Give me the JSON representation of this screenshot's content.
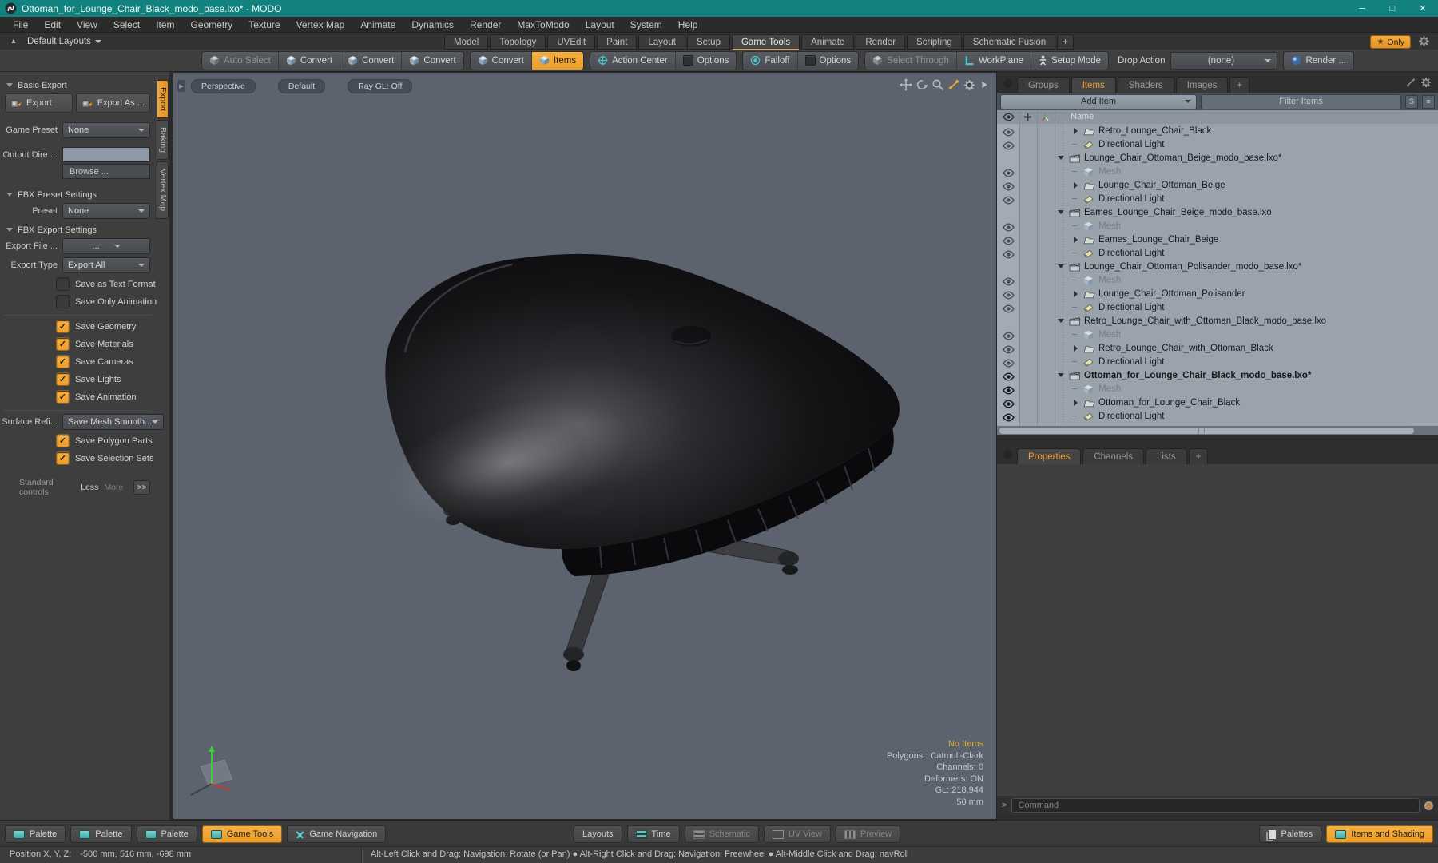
{
  "window": {
    "title": "Ottoman_for_Lounge_Chair_Black_modo_base.lxo* - MODO"
  },
  "colors": {
    "accent_orange": "#f0a030",
    "titlebar_teal": "#11827e",
    "icon_teal": "#4fc3c7",
    "list_bg": "#9aa3ac",
    "viewport_bg": "#5c636e",
    "no_items_text": "#e0ad3c"
  },
  "menubar": {
    "items": [
      {
        "label": "File"
      },
      {
        "label": "Edit"
      },
      {
        "label": "View"
      },
      {
        "label": "Select"
      },
      {
        "label": "Item"
      },
      {
        "label": "Geometry"
      },
      {
        "label": "Texture"
      },
      {
        "label": "Vertex Map"
      },
      {
        "label": "Animate"
      },
      {
        "label": "Dynamics"
      },
      {
        "label": "Render"
      },
      {
        "label": "MaxToModo"
      },
      {
        "label": "Layout"
      },
      {
        "label": "System"
      },
      {
        "label": "Help"
      }
    ]
  },
  "layouts_row": {
    "switcher": "Default Layouts",
    "tabs": [
      {
        "label": "Model"
      },
      {
        "label": "Topology"
      },
      {
        "label": "UVEdit"
      },
      {
        "label": "Paint"
      },
      {
        "label": "Layout"
      },
      {
        "label": "Setup"
      },
      {
        "label": "Game Tools",
        "active": true
      },
      {
        "label": "Animate"
      },
      {
        "label": "Render"
      },
      {
        "label": "Scripting"
      },
      {
        "label": "Schematic Fusion"
      },
      {
        "label": "+",
        "add": true
      }
    ],
    "only_button": "Only"
  },
  "toolbar": {
    "auto_select": "Auto Select",
    "convert1": "Convert",
    "convert2": "Convert",
    "convert3": "Convert",
    "convert4": "Convert",
    "items": "Items",
    "action_center": "Action Center",
    "options1": "Options",
    "falloff": "Falloff",
    "options2": "Options",
    "select_through": "Select Through",
    "workplane": "WorkPlane",
    "setup_mode": "Setup Mode",
    "drop_action_label": "Drop Action",
    "drop_action_value": "(none)",
    "render": "Render ..."
  },
  "left_panel": {
    "vertical_tabs": [
      {
        "label": "Export",
        "active": true
      },
      {
        "label": "Baking"
      },
      {
        "label": "Vertex Map"
      }
    ],
    "basic_export": {
      "title": "Basic Export",
      "export_button": "Export",
      "export_as_button": "Export As ...",
      "game_preset_label": "Game Preset",
      "game_preset_value": "None",
      "output_dir_label": "Output Dire ...",
      "browse_button": "Browse ..."
    },
    "fbx_preset": {
      "title": "FBX Preset Settings",
      "preset_label": "Preset",
      "preset_value": "None"
    },
    "fbx_export": {
      "title": "FBX Export Settings",
      "export_file_label": "Export File ...",
      "export_file_value": "...",
      "export_type_label": "Export Type",
      "export_type_value": "Export All",
      "plain_checkboxes": [
        {
          "label": "Save as Text Format"
        },
        {
          "label": "Save Only Animation"
        }
      ],
      "save_checkboxes": [
        {
          "label": "Save Geometry",
          "checked": true
        },
        {
          "label": "Save Materials",
          "checked": true
        },
        {
          "label": "Save Cameras",
          "checked": true
        },
        {
          "label": "Save Lights",
          "checked": true
        },
        {
          "label": "Save Animation",
          "checked": true
        }
      ],
      "surface_label": "Surface Refi...",
      "surface_value": "Save Mesh Smooth...",
      "extra_checkboxes": [
        {
          "label": "Save Polygon Parts",
          "checked": true
        },
        {
          "label": "Save Selection Sets",
          "checked": true
        }
      ],
      "footer_label": "Standard controls",
      "footer_less": "Less",
      "footer_more": "More",
      "footer_expand": ">>"
    }
  },
  "viewport": {
    "mode_buttons": [
      {
        "label": "Perspective"
      },
      {
        "label": "Default"
      },
      {
        "label": "Ray GL: Off"
      }
    ],
    "status_highlight": "No Items",
    "status_lines": [
      {
        "label": "Polygons : Catmull-Clark"
      },
      {
        "label": "Channels: 0"
      },
      {
        "label": "Deformers: ON"
      },
      {
        "label": "GL: 218,944"
      },
      {
        "label": "50 mm"
      }
    ]
  },
  "items_panel": {
    "tabs": [
      {
        "label": "Groups"
      },
      {
        "label": "Items",
        "active": true
      },
      {
        "label": "Shaders"
      },
      {
        "label": "Images"
      },
      {
        "label": "+",
        "add": true
      }
    ],
    "add_item_button": "Add Item",
    "filter_placeholder": "Filter Items",
    "name_header": "Name",
    "rows": [
      {
        "kind": "group",
        "caret": "right",
        "visible": true,
        "label": "Retro_Lounge_Chair_Black"
      },
      {
        "kind": "light",
        "caret": "none",
        "visible": true,
        "label": "Directional Light"
      },
      {
        "kind": "scene",
        "caret": "down",
        "label": "Lounge_Chair_Ottoman_Beige_modo_base.lxo*"
      },
      {
        "kind": "mesh",
        "caret": "none",
        "visible": true,
        "dim": true,
        "label": "Mesh"
      },
      {
        "kind": "group",
        "caret": "right",
        "visible": true,
        "label": "Lounge_Chair_Ottoman_Beige"
      },
      {
        "kind": "light",
        "caret": "none",
        "visible": true,
        "label": "Directional Light"
      },
      {
        "kind": "scene",
        "caret": "down",
        "label": "Eames_Lounge_Chair_Beige_modo_base.lxo"
      },
      {
        "kind": "mesh",
        "caret": "none",
        "visible": true,
        "dim": true,
        "label": "Mesh"
      },
      {
        "kind": "group",
        "caret": "right",
        "visible": true,
        "label": "Eames_Lounge_Chair_Beige"
      },
      {
        "kind": "light",
        "caret": "none",
        "visible": true,
        "label": "Directional Light"
      },
      {
        "kind": "scene",
        "caret": "down",
        "label": "Lounge_Chair_Ottoman_Polisander_modo_base.lxo*"
      },
      {
        "kind": "mesh",
        "caret": "none",
        "visible": true,
        "dim": true,
        "label": "Mesh"
      },
      {
        "kind": "group",
        "caret": "right",
        "visible": true,
        "label": "Lounge_Chair_Ottoman_Polisander"
      },
      {
        "kind": "light",
        "caret": "none",
        "visible": true,
        "label": "Directional Light"
      },
      {
        "kind": "scene",
        "caret": "down",
        "label": "Retro_Lounge_Chair_with_Ottoman_Black_modo_base.lxo"
      },
      {
        "kind": "mesh",
        "caret": "none",
        "visible": true,
        "dim": true,
        "label": "Mesh"
      },
      {
        "kind": "group",
        "caret": "right",
        "visible": true,
        "label": "Retro_Lounge_Chair_with_Ottoman_Black"
      },
      {
        "kind": "light",
        "caret": "none",
        "visible": true,
        "label": "Directional Light"
      },
      {
        "kind": "scene",
        "caret": "down",
        "visible": true,
        "strong": true,
        "eyebold": true,
        "label": "Ottoman_for_Lounge_Chair_Black_modo_base.lxo*"
      },
      {
        "kind": "mesh",
        "caret": "none",
        "visible": true,
        "dim": true,
        "eyebold": true,
        "label": "Mesh"
      },
      {
        "kind": "group",
        "caret": "right",
        "visible": true,
        "eyebold": true,
        "label": "Ottoman_for_Lounge_Chair_Black"
      },
      {
        "kind": "light",
        "caret": "none",
        "visible": true,
        "eyebold": true,
        "label": "Directional Light"
      }
    ]
  },
  "properties_panel": {
    "tabs": [
      {
        "label": "Properties",
        "active": true
      },
      {
        "label": "Channels"
      },
      {
        "label": "Lists"
      },
      {
        "label": "+",
        "add": true
      }
    ]
  },
  "command_bar": {
    "prompt": ">",
    "placeholder": "Command"
  },
  "bottom_bar": {
    "left": [
      {
        "label": "Palette",
        "icon": "swatch"
      },
      {
        "label": "Palette",
        "icon": "swatch"
      },
      {
        "label": "Palette",
        "icon": "swatch"
      },
      {
        "label": "Game Tools",
        "icon": "swatch",
        "active": true
      },
      {
        "label": "Game Navigation",
        "icon": "gamenav"
      }
    ],
    "center": [
      {
        "label": "Layouts",
        "icon": "none"
      },
      {
        "label": "Time",
        "icon": "time"
      },
      {
        "label": "Schematic",
        "icon": "schematic",
        "state": "disabled"
      },
      {
        "label": "UV View",
        "icon": "uv",
        "state": "disabled"
      },
      {
        "label": "Preview",
        "icon": "preview",
        "state": "disabled"
      }
    ],
    "right": [
      {
        "label": "Palettes",
        "icon": "pages"
      },
      {
        "label": "Items and Shading",
        "icon": "swatch",
        "active": true
      }
    ]
  },
  "status_bar": {
    "position_label": "Position X, Y, Z:",
    "position_value": "-500 mm, 516 mm, -698 mm",
    "nav_hints": "Alt-Left Click and Drag: Navigation: Rotate (or Pan)  ●  Alt-Right Click and Drag: Navigation: Freewheel  ●  Alt-Middle Click and Drag: navRoll"
  }
}
